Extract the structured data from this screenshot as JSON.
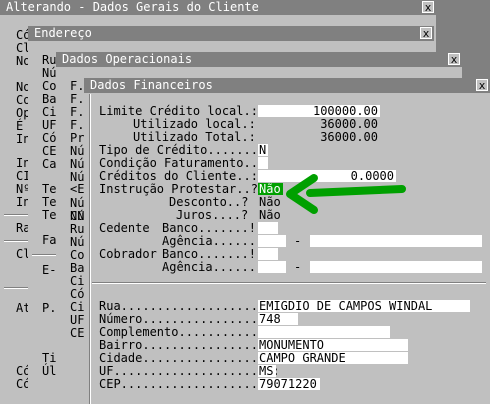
{
  "window1": {
    "title": "Alterando - Dados Gerais do Cliente",
    "close": "x",
    "frags": [
      "Có",
      "Cl",
      "No",
      "No",
      "Co",
      "Op",
      "É",
      "In",
      "In",
      "CI",
      "Nº",
      "In",
      "Ra",
      "Cl",
      "At",
      "Có",
      "Có"
    ]
  },
  "window2": {
    "title": "Endereço",
    "close": "x",
    "frags": [
      "Ru",
      "Nú",
      "Co",
      "Ba",
      "Ci",
      "UF",
      "Có",
      "CE",
      "Ca",
      "Te",
      "Te",
      "Te",
      "Fa",
      "E-",
      "P.",
      "Ti",
      "Úl"
    ]
  },
  "window3": {
    "title": "Dados Operacionais",
    "close": "x",
    "frags": [
      "F.",
      "F.",
      "F.",
      "F.",
      "Pr",
      "Nú",
      "Nú",
      "Nú",
      "Nú",
      "Nú",
      "Nú",
      "<E",
      "CN",
      "Ru",
      "Nú",
      "Co",
      "Ba",
      "Ci",
      "Có",
      "Ci",
      "UF",
      "CE"
    ]
  },
  "window4": {
    "title": "Dados Financeiros",
    "close": "x",
    "limite_label": "Limite Crédito local.:",
    "limite_value": "100000.00",
    "utilizado_local_label": "Utilizado local.:",
    "utilizado_local_value": "36000.00",
    "utilizado_total_label": "Utilizado Total.:",
    "utilizado_total_value": "36000.00",
    "tipo_credito_label": "Tipo de Crédito.......!",
    "tipo_credito_value": "N",
    "condicao_label": "Condição Faturamento..!",
    "creditos_label": "Créditos do Cliente..:",
    "creditos_value": "0.0000",
    "instrucao_label": "Instrução Protestar..?",
    "instrucao_value": "Não",
    "desconto_label": "Desconto..?",
    "desconto_value": "Não",
    "juros_label": "Juros....?",
    "juros_value": "Não",
    "cedente_label": "Cedente",
    "cedente_banco_label": "Banco.......!",
    "cedente_agencia_label": "Agência......!",
    "cobrador_label": "Cobrador",
    "cobrador_banco_label": "Banco.......!",
    "cobrador_agencia_label": "Agência......!",
    "dash": "-",
    "rua_label": "Rua.....................:",
    "rua_value": "EMIGDIO DE CAMPOS WINDAL",
    "numero_label": "Número..................:",
    "numero_value": "748",
    "complemento_label": "Complemento.............:",
    "complemento_value": "",
    "bairro_label": "Bairro..................:",
    "bairro_value": "MONUMENTO",
    "cidade_label": "Cidade..................:",
    "cidade_value": "CAMPO GRANDE",
    "uf_label": "UF......................:",
    "uf_value": "MS",
    "cep_label": "CEP.....................:",
    "cep_value": "79071220",
    "arrow_color": "#00a000"
  }
}
